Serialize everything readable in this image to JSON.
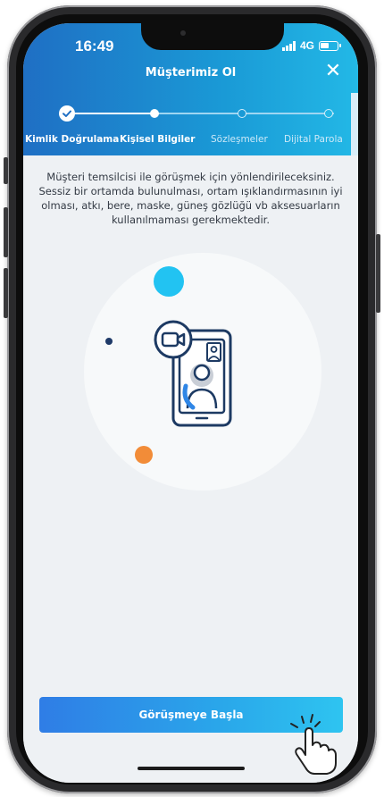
{
  "status_bar": {
    "time": "16:49",
    "network": "4G"
  },
  "header": {
    "title": "Müşterimiz Ol",
    "close_glyph": "✕"
  },
  "steps": [
    {
      "label": "Kimlik Doğrulama",
      "state": "done"
    },
    {
      "label": "Kişisel Bilgiler",
      "state": "current"
    },
    {
      "label": "Sözleşmeler",
      "state": "upcoming"
    },
    {
      "label": "Dijital Parola",
      "state": "upcoming"
    }
  ],
  "description": "Müşteri temsilcisi ile görüşmek için yönlendirileceksiniz. Sessiz bir ortamda bulunulması, ortam ışıklandırmasının iyi olması, atkı, bere, maske, güneş gözlüğü vb aksesuarların kullanılmaması gerekmektedir.",
  "illustration": {
    "icon": "video-call-phone-icon"
  },
  "cta": {
    "label": "Görüşmeye Başla"
  },
  "colors": {
    "header_start": "#1f6fc4",
    "header_end": "#23b8e6",
    "dot_cyan": "#22c3f2",
    "dot_orange": "#f28c38",
    "dot_navy": "#1f3a68",
    "icon_stroke": "#1d3a63"
  }
}
